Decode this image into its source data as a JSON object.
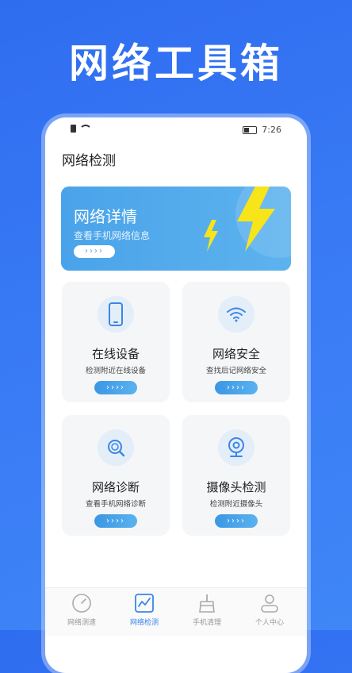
{
  "headline": "网络工具箱",
  "status": {
    "time": "7:26"
  },
  "page_title": "网络检测",
  "banner": {
    "title": "网络详情",
    "subtitle": "查看手机网络信息",
    "button": "››››"
  },
  "cards": [
    {
      "title": "在线设备",
      "subtitle": "检测附近在线设备",
      "button": "››››",
      "icon": "phone-icon"
    },
    {
      "title": "网络安全",
      "subtitle": "查找后记网络安全",
      "button": "››››",
      "icon": "wifi-icon"
    },
    {
      "title": "网络诊断",
      "subtitle": "查看手机网络诊断",
      "button": "››››",
      "icon": "magnifier-icon"
    },
    {
      "title": "摄像头检测",
      "subtitle": "检测附近摄像头",
      "button": "››››",
      "icon": "camera-icon"
    }
  ],
  "tabs": [
    {
      "label": "网络测速",
      "icon": "speedometer-icon"
    },
    {
      "label": "网络检测",
      "icon": "chart-icon",
      "active": true
    },
    {
      "label": "手机清理",
      "icon": "broom-icon"
    },
    {
      "label": "个人中心",
      "icon": "user-icon"
    }
  ],
  "colors": {
    "accent": "#3a86e8",
    "background": "#2f6df0",
    "bolt": "#f7e51a"
  }
}
